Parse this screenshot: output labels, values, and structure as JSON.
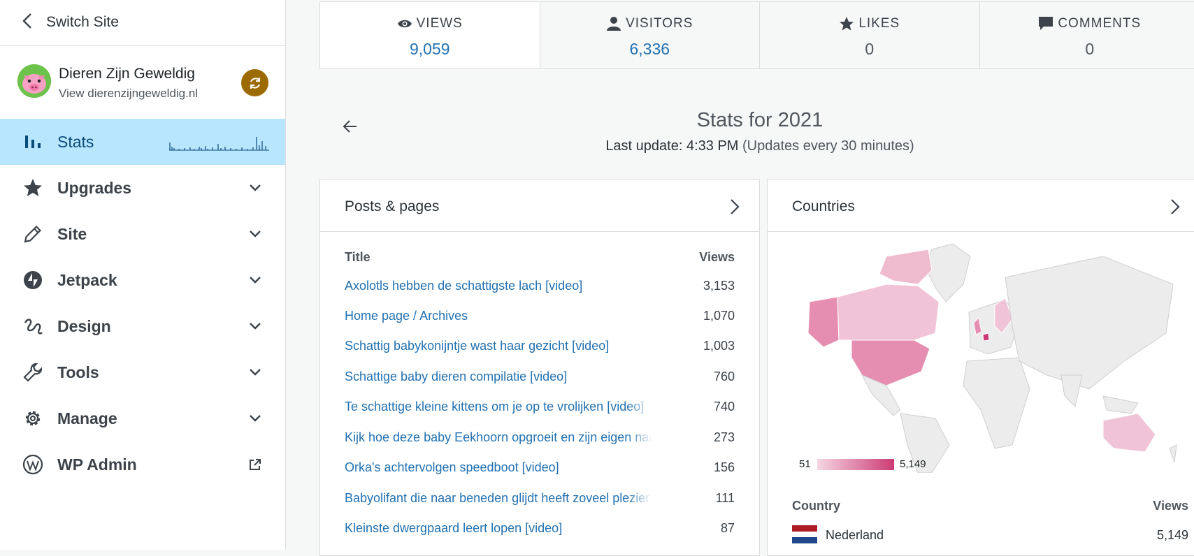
{
  "sidebar": {
    "switch_site": "Switch Site",
    "site_name": "Dieren Zijn Geweldig",
    "site_url": "View dierenzijngeweldig.nl",
    "items": [
      {
        "label": "Stats",
        "icon": "stats-icon",
        "active": true
      },
      {
        "label": "Upgrades",
        "icon": "star-icon"
      },
      {
        "label": "Site",
        "icon": "pencil-icon"
      },
      {
        "label": "Jetpack",
        "icon": "jetpack-icon"
      },
      {
        "label": "Design",
        "icon": "design-icon"
      },
      {
        "label": "Tools",
        "icon": "wrench-icon"
      },
      {
        "label": "Manage",
        "icon": "gear-icon"
      },
      {
        "label": "WP Admin",
        "icon": "wordpress-icon"
      }
    ]
  },
  "summary": [
    {
      "label": "VIEWS",
      "value": "9,059",
      "icon": "eye-icon"
    },
    {
      "label": "VISITORS",
      "value": "6,336",
      "icon": "person-icon"
    },
    {
      "label": "LIKES",
      "value": "0",
      "icon": "star-icon"
    },
    {
      "label": "COMMENTS",
      "value": "0",
      "icon": "comment-icon"
    }
  ],
  "stats": {
    "title": "Stats for 2021",
    "update_prefix": "Last update: 4:33 PM",
    "update_suffix": " (Updates every 30 minutes)"
  },
  "posts": {
    "title": "Posts & pages",
    "col_title": "Title",
    "col_views": "Views",
    "rows": [
      {
        "title": "Axolotls hebben de schattigste lach [video]",
        "views": "3,153"
      },
      {
        "title": "Home page / Archives",
        "views": "1,070"
      },
      {
        "title": "Schattig babykonijntje wast haar gezicht [video]",
        "views": "1,003"
      },
      {
        "title": "Schattige baby dieren compilatie [video]",
        "views": "760"
      },
      {
        "title": "Te schattige kleine kittens om je op te vrolijken [video]",
        "views": "740"
      },
      {
        "title": "Kijk hoe deze baby Eekhoorn opgroeit en zijn eigen naam",
        "views": "273"
      },
      {
        "title": "Orka's achtervolgen speedboot [video]",
        "views": "156"
      },
      {
        "title": "Babyolifant die naar beneden glijdt heeft zoveel plezier",
        "views": "111"
      },
      {
        "title": "Kleinste dwergpaard leert lopen [video]",
        "views": "87"
      }
    ]
  },
  "countries": {
    "title": "Countries",
    "legend_min": "51",
    "legend_max": "5,149",
    "col_country": "Country",
    "col_views": "Views",
    "rows": [
      {
        "name": "Nederland",
        "views": "5,149"
      }
    ]
  },
  "colors": {
    "accent": "#2271b1",
    "active_nav": "#b8e6ff",
    "map_high": "#cc3b75",
    "map_low": "#f5d6e2"
  }
}
